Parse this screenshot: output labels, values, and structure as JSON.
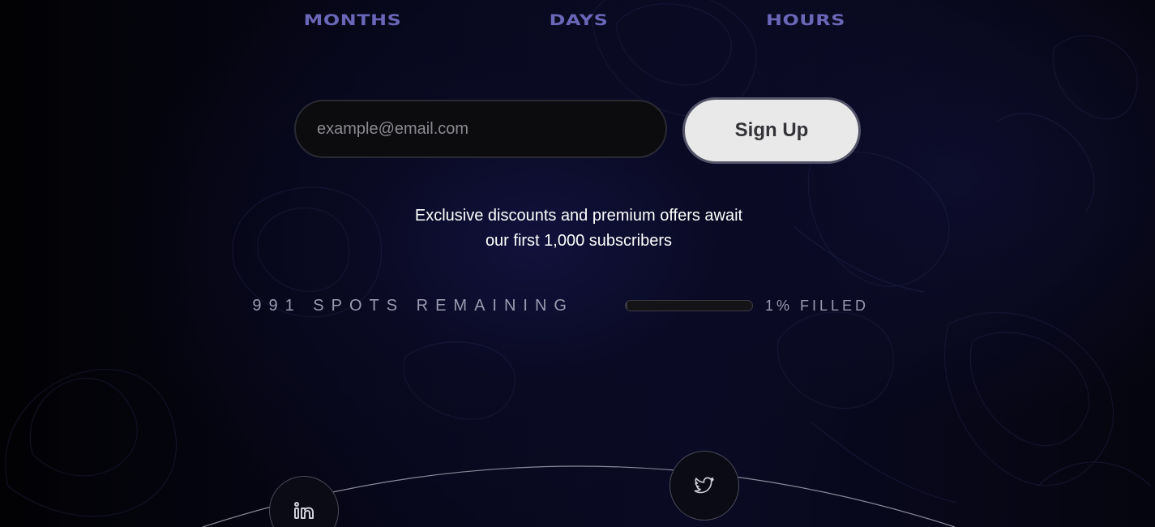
{
  "countdown": {
    "labels": [
      "MONTHS",
      "DAYS",
      "HOURS"
    ]
  },
  "signup": {
    "email_placeholder": "example@email.com",
    "button_label": "Sign Up"
  },
  "promo": {
    "line1": "Exclusive discounts and premium offers await",
    "line2": "our first 1,000 subscribers"
  },
  "spots": {
    "remaining_text": "991 SPOTS REMAINING",
    "filled_text": "1% FILLED",
    "progress_fraction": 0.01
  },
  "social": {
    "icons": [
      "linkedin-icon",
      "twitter-icon"
    ]
  },
  "colors": {
    "accent_label": "#6b67b8",
    "button_bg": "#e9e9ea",
    "background": "#05050d"
  }
}
